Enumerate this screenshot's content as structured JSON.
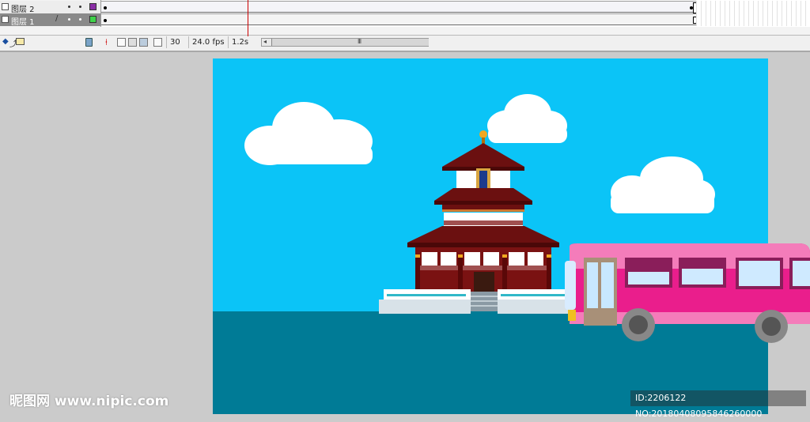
{
  "timeline": {
    "layers": [
      {
        "name": "图层 2",
        "swatch_color": "#8b2ea6",
        "selected": false
      },
      {
        "name": "图层 1",
        "swatch_color": "#3fd24a",
        "selected": true
      }
    ],
    "current_frame": "30",
    "frame_rate": "24.0 fps",
    "elapsed_time": "1.2s",
    "scroll_grip": "III",
    "scroll_left_arrow": "◂"
  },
  "toolbar_icons": [
    "add-layer-icon",
    "add-motion-guide-icon",
    "add-folder-icon",
    "delete-layer-icon",
    "center-frame-icon",
    "onion-skin-icon",
    "onion-skin-outlines-icon",
    "edit-multiple-frames-icon",
    "modify-onion-markers-icon"
  ],
  "stage": {
    "sky_color": "#0bc4f7",
    "water_color": "#007b96",
    "cloud_color": "#ffffff",
    "temple_roof_color": "#6b1010",
    "bus_color": "#ea1e8c"
  },
  "watermark": {
    "left": "昵图网 www.nipic.com",
    "right": "ID:2206122 NO:20180408095846260000"
  }
}
